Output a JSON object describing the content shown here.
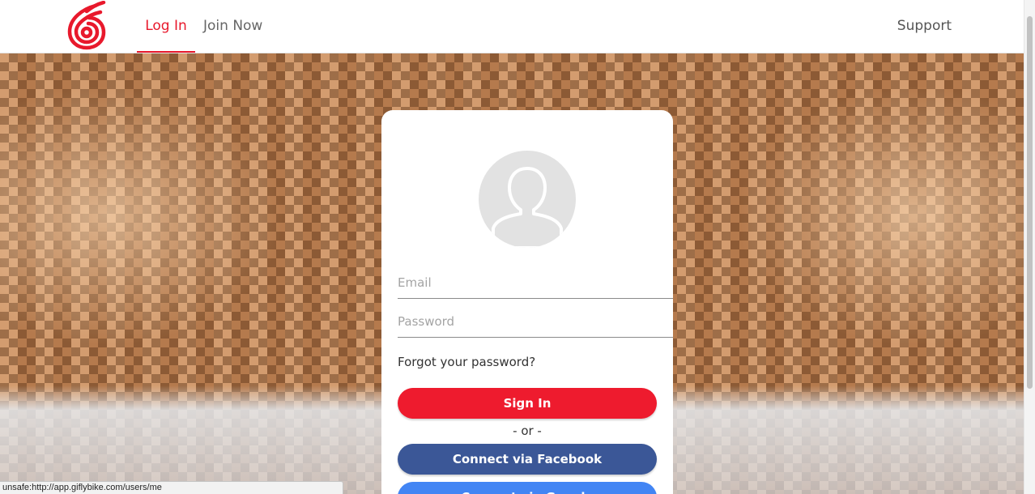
{
  "header": {
    "tabs": [
      {
        "label": "Log In",
        "active": true
      },
      {
        "label": "Join Now",
        "active": false
      }
    ],
    "support_label": "Support",
    "brand_color": "#e8192c"
  },
  "login": {
    "email_placeholder": "Email",
    "password_placeholder": "Password",
    "forgot_label": "Forgot your password?",
    "signin_label": "Sign In",
    "or_label": "- or -",
    "facebook_label": "Connect via Facebook",
    "google_label": "Connect via Google",
    "signin_color": "#ee1b2e",
    "facebook_color": "#3b5797",
    "google_color": "#4285f4"
  },
  "status": {
    "url": "unsafe:http://app.giflybike.com/users/me"
  }
}
